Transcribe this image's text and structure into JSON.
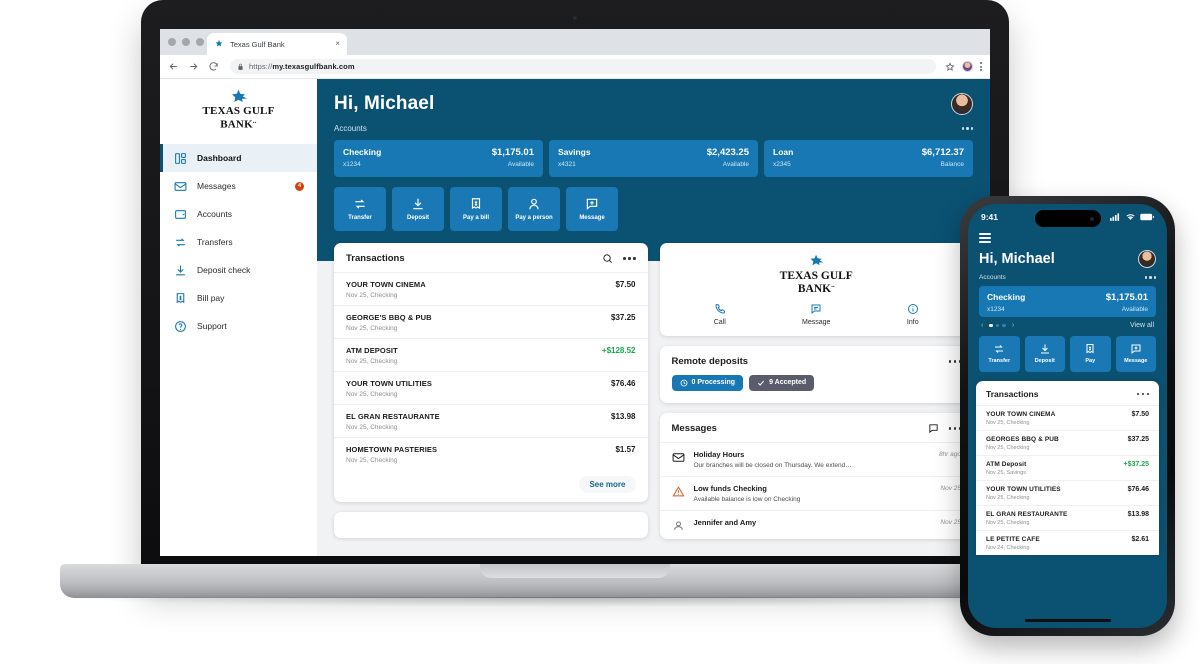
{
  "browser": {
    "tab_title": "Texas Gulf Bank",
    "tab_close": "×",
    "url_prefix": "https://",
    "url_domain": "my.texasgulfbank.com"
  },
  "brand": {
    "line1": "TEXAS GULF",
    "line2": "BANK",
    "tm": ".."
  },
  "sidebar": {
    "items": [
      {
        "label": "Dashboard",
        "icon": "dashboard-icon",
        "active": true,
        "badge": ""
      },
      {
        "label": "Messages",
        "icon": "envelope-icon",
        "active": false,
        "badge": "4"
      },
      {
        "label": "Accounts",
        "icon": "wallet-icon",
        "active": false,
        "badge": ""
      },
      {
        "label": "Transfers",
        "icon": "transfer-arrows-icon",
        "active": false,
        "badge": ""
      },
      {
        "label": "Deposit check",
        "icon": "download-icon",
        "active": false,
        "badge": ""
      },
      {
        "label": "Bill pay",
        "icon": "bill-icon",
        "active": false,
        "badge": ""
      },
      {
        "label": "Support",
        "icon": "question-circle-icon",
        "active": false,
        "badge": ""
      }
    ]
  },
  "hero": {
    "greeting": "Hi, Michael",
    "accounts_label": "Accounts",
    "accounts": [
      {
        "name": "Checking",
        "amount": "$1,175.01",
        "number": "x1234",
        "kind": "Available"
      },
      {
        "name": "Savings",
        "amount": "$2,423.25",
        "number": "x4321",
        "kind": "Available"
      },
      {
        "name": "Loan",
        "amount": "$6,712.37",
        "number": "x2345",
        "kind": "Balance"
      }
    ],
    "quick_actions": [
      {
        "label": "Transfer",
        "icon": "transfer-arrows-icon"
      },
      {
        "label": "Deposit",
        "icon": "download-icon"
      },
      {
        "label": "Pay a bill",
        "icon": "bill-icon"
      },
      {
        "label": "Pay a person",
        "icon": "person-icon"
      },
      {
        "label": "Message",
        "icon": "message-plus-icon"
      }
    ]
  },
  "transactions_card": {
    "title": "Transactions",
    "search_icon": "search-icon",
    "menu_icon": "kebab-menu-icon",
    "see_more": "See more",
    "rows": [
      {
        "name": "YOUR TOWN CINEMA",
        "sub": "Nov 25, Checking",
        "amount": "$7.50",
        "positive": false
      },
      {
        "name": "GEORGE'S BBQ & PUB",
        "sub": "Nov 25, Checking",
        "amount": "$37.25",
        "positive": false
      },
      {
        "name": "ATM DEPOSIT",
        "sub": "Nov 25, Checking",
        "amount": "+$128.52",
        "positive": true
      },
      {
        "name": "YOUR TOWN UTILITIES",
        "sub": "Nov 25, Checking",
        "amount": "$76.46",
        "positive": false
      },
      {
        "name": "EL GRAN RESTAURANTE",
        "sub": "Nov 25, Checking",
        "amount": "$13.98",
        "positive": false
      },
      {
        "name": "HOMETOWN PASTERIES",
        "sub": "Nov 25, Checking",
        "amount": "$1.57",
        "positive": false
      }
    ]
  },
  "contact_card": {
    "brand_line1": "TEXAS GULF",
    "brand_line2": "BANK",
    "brand_tm": "..",
    "actions": [
      {
        "label": "Call",
        "icon": "phone-icon"
      },
      {
        "label": "Message",
        "icon": "message-icon"
      },
      {
        "label": "Info",
        "icon": "info-circle-icon"
      }
    ]
  },
  "remote_deposits": {
    "title": "Remote deposits",
    "menu_icon": "kebab-menu-icon",
    "chips": [
      {
        "label": "0 Processing",
        "icon": "clock-icon",
        "style": "blue"
      },
      {
        "label": "9 Accepted",
        "icon": "check-icon",
        "style": "gray"
      }
    ]
  },
  "messages_card": {
    "title": "Messages",
    "compose_icon": "message-icon",
    "menu_icon": "kebab-menu-icon",
    "rows": [
      {
        "title": "Holiday Hours",
        "sub": "Our branches will be closed on Thursday. We extend…",
        "time": "8hr ago",
        "icon": "envelope-icon"
      },
      {
        "title": "Low funds Checking",
        "sub": "Available balance is low on Checking",
        "time": "Nov 25",
        "icon": "warning-icon"
      },
      {
        "title": "Jennifer and Amy",
        "sub": "",
        "time": "Nov 25",
        "icon": "avatar-icon"
      }
    ]
  },
  "phone": {
    "status_time": "9:41",
    "menu_icon": "hamburger-icon",
    "greeting": "Hi, Michael",
    "accounts_label": "Accounts",
    "account": {
      "name": "Checking",
      "amount": "$1,175.01",
      "number": "x1234",
      "kind": "Available"
    },
    "pager": {
      "prev": "‹",
      "next": "›",
      "view_all": "View all"
    },
    "quick_actions": [
      {
        "label": "Transfer",
        "icon": "transfer-arrows-icon"
      },
      {
        "label": "Deposit",
        "icon": "download-icon"
      },
      {
        "label": "Pay",
        "icon": "bill-icon"
      },
      {
        "label": "Message",
        "icon": "message-plus-icon"
      }
    ],
    "transactions_title": "Transactions",
    "menu_dots_icon": "kebab-menu-icon",
    "transactions": [
      {
        "name": "YOUR TOWN CINEMA",
        "sub": "Nov 25, Checking",
        "amount": "$7.50",
        "positive": false
      },
      {
        "name": "GEORGES BBQ & PUB",
        "sub": "Nov 25, Checking",
        "amount": "$37.25",
        "positive": false
      },
      {
        "name": "ATM Deposit",
        "sub": "Nov 25, Savings",
        "amount": "+$37.25",
        "positive": true
      },
      {
        "name": "YOUR TOWN UTILITIES",
        "sub": "Nov 25, Checking",
        "amount": "$76.46",
        "positive": false
      },
      {
        "name": "EL GRAN RESTAURANTE",
        "sub": "Nov 25, Checking",
        "amount": "$13.98",
        "positive": false
      },
      {
        "name": "LE PETITE CAFE",
        "sub": "Nov 24, Checking",
        "amount": "$2.61",
        "positive": false
      }
    ]
  },
  "colors": {
    "hero_blue": "#0b5172",
    "card_blue": "#1878b4",
    "accent_green": "#1aa64b",
    "badge_red": "#d8410c",
    "chip_gray": "#5a5c6b"
  }
}
